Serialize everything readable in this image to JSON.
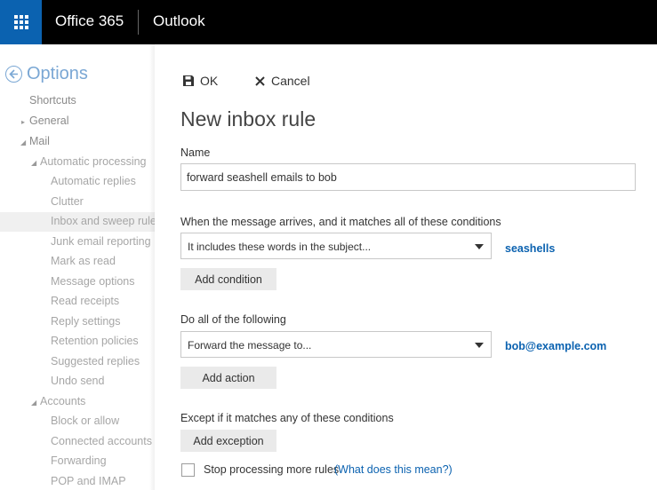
{
  "header": {
    "brand": "Office 365",
    "app_name": "Outlook",
    "waffle_icon": "app-launcher-icon",
    "colors": {
      "bar": "#000000",
      "waffle": "#0b62b0"
    }
  },
  "sidebar": {
    "title": "Options",
    "shortcuts": "Shortcuts",
    "general": "General",
    "mail": "Mail",
    "automatic_processing": "Automatic processing",
    "items": [
      "Automatic replies",
      "Clutter",
      "Inbox and sweep rules",
      "Junk email reporting",
      "Mark as read",
      "Message options",
      "Read receipts",
      "Reply settings",
      "Retention policies",
      "Suggested replies",
      "Undo send"
    ],
    "accounts": "Accounts",
    "account_items": [
      "Block or allow",
      "Connected accounts",
      "Forwarding",
      "POP and IMAP"
    ]
  },
  "form": {
    "ok_label": "OK",
    "cancel_label": "Cancel",
    "title": "New inbox rule",
    "name_label": "Name",
    "name_value": "forward seashell emails to bob",
    "conditions_label": "When the message arrives, and it matches all of these conditions",
    "condition_select": "It includes these words in the subject...",
    "condition_value": "seashells",
    "add_condition": "Add condition",
    "actions_label": "Do all of the following",
    "action_select": "Forward the message to...",
    "action_value": "bob@example.com",
    "add_action": "Add action",
    "exceptions_label": "Except if it matches any of these conditions",
    "add_exception": "Add exception",
    "stop_processing": "Stop processing more rules",
    "help_link": "(What does this mean?)",
    "link_color": "#0b62b0"
  }
}
